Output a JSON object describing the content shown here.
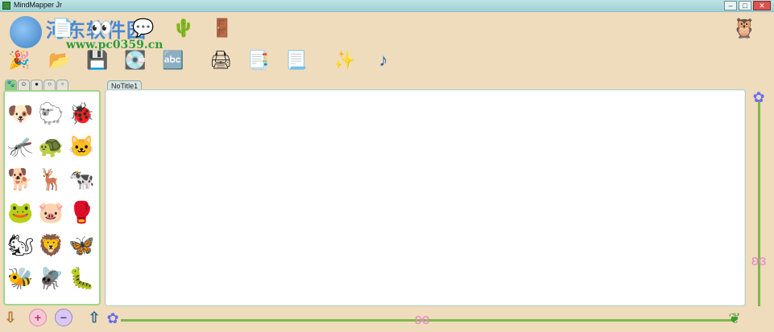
{
  "window": {
    "title": "MindMapper Jr",
    "minimize": "–",
    "maximize": "□",
    "close": "✕"
  },
  "watermark": {
    "title": "河东软件园",
    "url": "www.pc0359.cn"
  },
  "toolbar": {
    "row1": [
      {
        "name": "new-map-icon",
        "glyph": "📄"
      },
      {
        "name": "eyes-icon",
        "glyph": "👀"
      },
      {
        "name": "speech-bubble-icon",
        "glyph": "💬"
      },
      {
        "name": "cactus-icon",
        "glyph": "🌵"
      },
      {
        "name": "exit-door-icon",
        "glyph": "🚪"
      }
    ],
    "row2": [
      {
        "name": "party-hat-icon",
        "glyph": "🎉"
      },
      {
        "name": "open-folder-icon",
        "glyph": "📂"
      },
      {
        "name": "save-icon",
        "glyph": "💾"
      },
      {
        "name": "save-as-icon",
        "glyph": "💽"
      },
      {
        "name": "letters-icon",
        "glyph": "🔤"
      },
      {
        "name": "printer-icon",
        "glyph": "🖨"
      },
      {
        "name": "print-preview-icon",
        "glyph": "📑"
      },
      {
        "name": "document-icon",
        "glyph": "📃"
      },
      {
        "name": "sparkle-document-icon",
        "glyph": "✨"
      },
      {
        "name": "music-note-icon",
        "glyph": "♪"
      }
    ],
    "helper": {
      "name": "owl-helper-icon",
      "glyph": "🦉"
    }
  },
  "palette": {
    "tabs": [
      {
        "name": "tab-animals",
        "glyph": "🐾"
      },
      {
        "name": "tab-faces",
        "glyph": "☺"
      },
      {
        "name": "tab-objects",
        "glyph": "●"
      },
      {
        "name": "tab-bubbles",
        "glyph": "○"
      },
      {
        "name": "tab-misc",
        "glyph": "▫"
      }
    ],
    "animals": [
      {
        "name": "dog-sticker-icon",
        "glyph": "🐶"
      },
      {
        "name": "sheep-sticker-icon",
        "glyph": "🐑"
      },
      {
        "name": "bug-sticker-icon",
        "glyph": "🐞"
      },
      {
        "name": "mosquito-sticker-icon",
        "glyph": "🦟"
      },
      {
        "name": "turtle-sticker-icon",
        "glyph": "🐢"
      },
      {
        "name": "cat-sticker-icon",
        "glyph": "🐱"
      },
      {
        "name": "dog-with-bone-sticker-icon",
        "glyph": "🐕"
      },
      {
        "name": "deer-sticker-icon",
        "glyph": "🦌"
      },
      {
        "name": "cow-sticker-icon",
        "glyph": "🐄"
      },
      {
        "name": "frog-sticker-icon",
        "glyph": "🐸"
      },
      {
        "name": "pig-sticker-icon",
        "glyph": "🐷"
      },
      {
        "name": "boxer-sheep-sticker-icon",
        "glyph": "🥊"
      },
      {
        "name": "squirrel-sticker-icon",
        "glyph": "🐿"
      },
      {
        "name": "lion-sticker-icon",
        "glyph": "🦁"
      },
      {
        "name": "butterfly-sticker-icon",
        "glyph": "🦋"
      },
      {
        "name": "bee-sticker-icon",
        "glyph": "🐝"
      },
      {
        "name": "dragonfly-sticker-icon",
        "glyph": "🪰"
      },
      {
        "name": "caterpillar-sticker-icon",
        "glyph": "🐛"
      }
    ]
  },
  "document": {
    "tab_title": "NoTitle1"
  },
  "bottom": {
    "down_arrow": "⇩",
    "zoom_in": "+",
    "zoom_out": "−",
    "up_arrow": "⇧",
    "flower": "✿",
    "butterfly": "ʚɞ",
    "leaf": "❦"
  },
  "colors": {
    "background": "#efdcbd",
    "accent_green": "#7fb84a",
    "titlebar": "#9fd1d6"
  }
}
